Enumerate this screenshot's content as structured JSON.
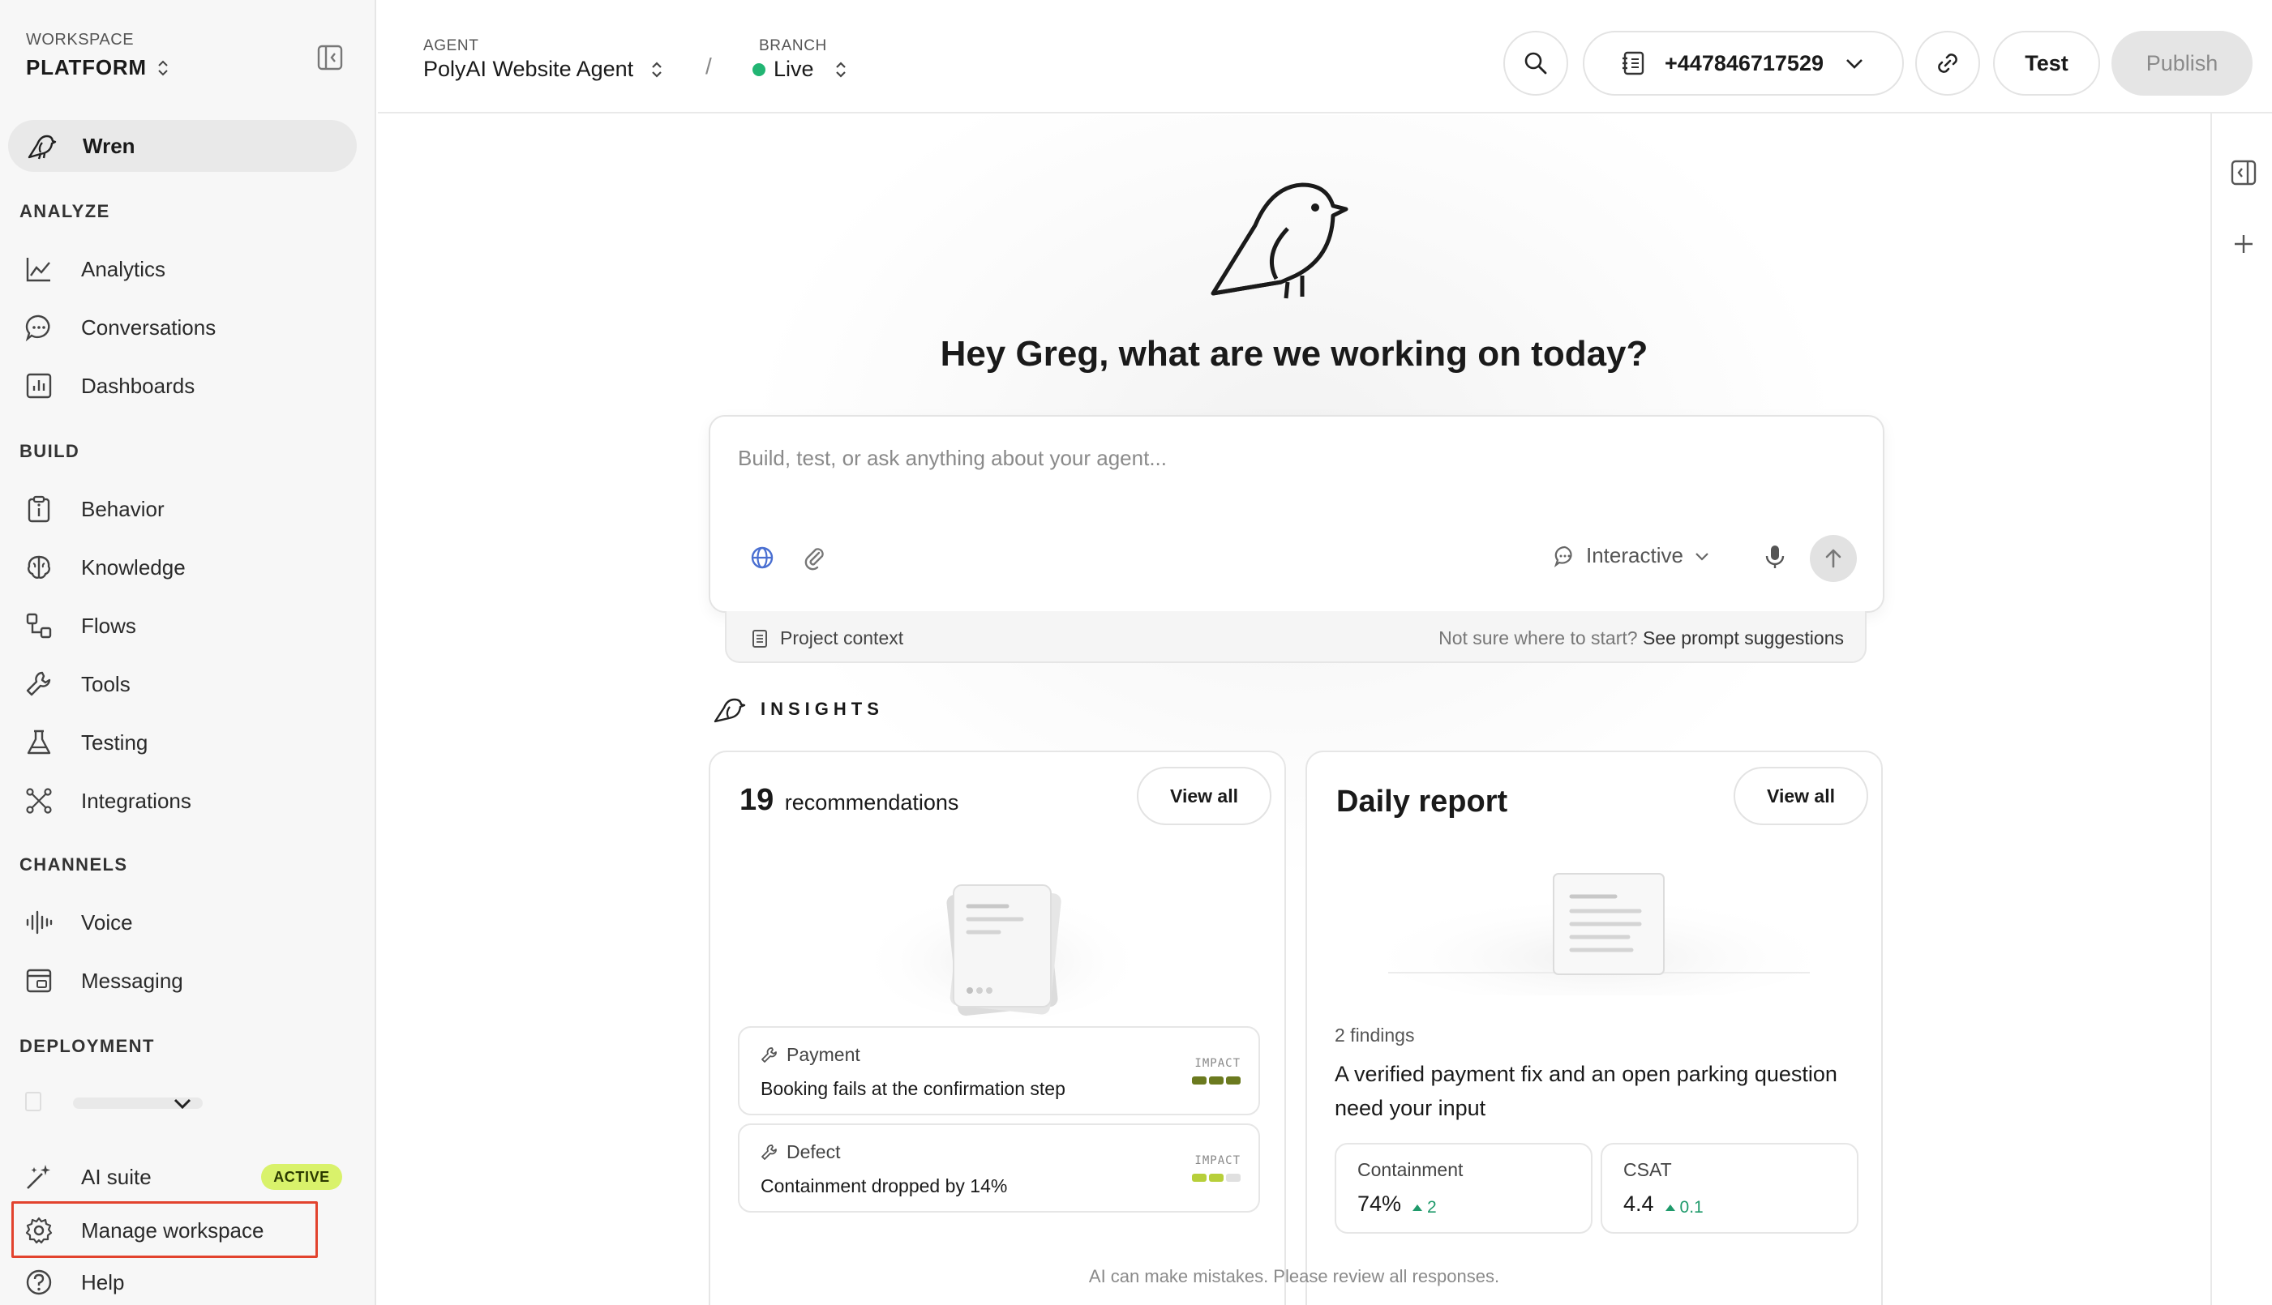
{
  "sidebar": {
    "workspace_label": "WORKSPACE",
    "workspace_name": "PLATFORM",
    "wren_label": "Wren",
    "sections": {
      "analyze": "ANALYZE",
      "build": "BUILD",
      "channels": "CHANNELS",
      "deployment": "DEPLOYMENT"
    },
    "analyze_items": [
      "Analytics",
      "Conversations",
      "Dashboards"
    ],
    "build_items": [
      "Behavior",
      "Knowledge",
      "Flows",
      "Tools",
      "Testing",
      "Integrations"
    ],
    "channel_items": [
      "Voice",
      "Messaging"
    ],
    "bottom": {
      "ai_suite": "AI suite",
      "ai_suite_badge": "ACTIVE",
      "manage_workspace": "Manage workspace",
      "help": "Help"
    }
  },
  "topbar": {
    "agent_label": "AGENT",
    "agent_name": "PolyAI Website Agent",
    "separator": "/",
    "branch_label": "BRANCH",
    "branch_name": "Live",
    "phone_number": "+447846717529",
    "test_label": "Test",
    "publish_label": "Publish"
  },
  "main": {
    "greeting": "Hey Greg, what are we working on today?",
    "prompt_placeholder": "Build, test, or ask anything about your agent...",
    "mode_label": "Interactive",
    "context_label": "Project context",
    "suggestion_prefix": "Not sure where to start?",
    "suggestion_link": "See prompt suggestions",
    "insights_label": "INSIGHTS",
    "disclaimer": "AI can make mistakes. Please review all responses."
  },
  "recommendations_card": {
    "count": "19",
    "title": "recommendations",
    "view_all": "View all",
    "items": [
      {
        "tag": "Payment",
        "description": "Booking fails at the confirmation step",
        "impact_label": "IMPACT",
        "impact_level": 3,
        "impact_max": 3,
        "impact_color": "#6b7a1f"
      },
      {
        "tag": "Defect",
        "description": "Containment dropped by 14%",
        "impact_label": "IMPACT",
        "impact_level": 2,
        "impact_max": 3,
        "impact_color": "#b7cf3a"
      }
    ]
  },
  "daily_report_card": {
    "title": "Daily report",
    "view_all": "View all",
    "findings": "2 findings",
    "headline": "A verified payment fix and an open parking question need your input",
    "metrics": [
      {
        "label": "Containment",
        "value": "74%",
        "delta": "2"
      },
      {
        "label": "CSAT",
        "value": "4.4",
        "delta": "0.1"
      }
    ]
  },
  "colors": {
    "live": "#22b573",
    "active_badge": "#d9f26b",
    "highlight": "#e2432e",
    "positive_delta": "#1f9a6b"
  }
}
